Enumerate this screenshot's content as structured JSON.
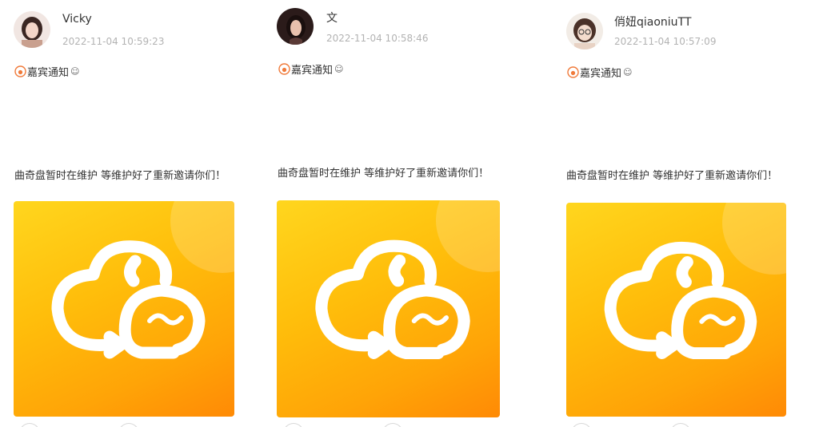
{
  "posts": [
    {
      "username": "Vicky",
      "timestamp": "2022-11-04 10:59:23",
      "tag": "嘉宾通知",
      "text": "曲奇盘暂时在维护 等维护好了重新邀请你们！",
      "avatar_color": "#c9a08f"
    },
    {
      "username": "文",
      "timestamp": "2022-11-04 10:58:46",
      "tag": "嘉宾通知",
      "text": "曲奇盘暂时在维护 等维护好了重新邀请你们！",
      "avatar_color": "#5a3a36"
    },
    {
      "username": "俏妞qiaoniuTT",
      "timestamp": "2022-11-04 10:57:09",
      "tag": "嘉宾通知",
      "text": "曲奇盘暂时在维护 等维护好了重新邀请你们！",
      "avatar_color": "#e8d2c4"
    }
  ],
  "icons": {
    "tag": "fire-badge-icon",
    "smile": "smiley-icon",
    "logo": "cloud-sync-logo-icon"
  },
  "colors": {
    "tag_icon": "#f07a3a",
    "image_top": "#ffd61e",
    "image_bottom": "#ff8a05"
  }
}
